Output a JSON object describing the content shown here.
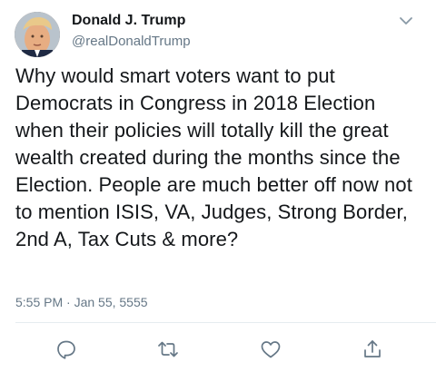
{
  "author": {
    "display_name": "Donald J. Trump",
    "handle": "@realDonaldTrump"
  },
  "tweet": {
    "text": "Why would smart voters want to put Democrats in Congress in 2018 Election when their policies will totally kill the great wealth created during the months since the Election. People are much better off now not to mention ISIS, VA, Judges, Strong Border, 2nd A, Tax Cuts & more?",
    "timestamp": "5:55 PM · Jan 55, 5555"
  },
  "icons": {
    "menu": "chevron-down-icon",
    "reply": "reply-icon",
    "retweet": "retweet-icon",
    "like": "heart-icon",
    "share": "share-icon"
  },
  "colors": {
    "text": "#14171a",
    "secondary": "#657786",
    "icon": "#657786",
    "divider": "#e6ecf0"
  }
}
